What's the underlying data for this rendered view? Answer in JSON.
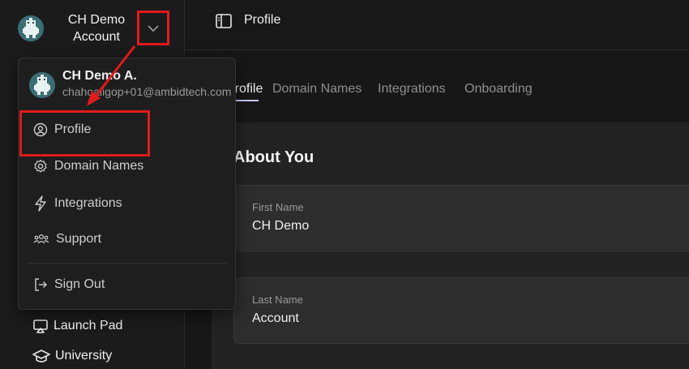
{
  "account": {
    "name_line1": "CH Demo",
    "name_line2": "Account"
  },
  "sidebar": {
    "items": [
      {
        "label": "Launch Pad",
        "icon": "airplay-icon"
      },
      {
        "label": "University",
        "icon": "graduation-cap-icon"
      }
    ]
  },
  "topbar": {
    "title": "Profile",
    "icon": "sidebar-panel-icon"
  },
  "tabs": [
    {
      "label": "Profile",
      "active": true
    },
    {
      "label": "Domain Names",
      "active": false
    },
    {
      "label": "Integrations",
      "active": false
    },
    {
      "label": "Onboarding",
      "active": false
    }
  ],
  "section": {
    "title": "About You"
  },
  "fields": [
    {
      "label": "First Name",
      "value": "CH Demo"
    },
    {
      "label": "Last Name",
      "value": "Account"
    }
  ],
  "menu": {
    "user_name": "CH Demo A.",
    "user_email": "chahoaligop+01@ambidtech.com",
    "items": [
      {
        "label": "Profile",
        "icon": "user-circle-icon"
      },
      {
        "label": "Domain Names",
        "icon": "gear-icon"
      },
      {
        "label": "Integrations",
        "icon": "lightning-icon"
      },
      {
        "label": "Support",
        "icon": "users-icon"
      },
      {
        "label": "Sign Out",
        "icon": "sign-out-icon"
      }
    ]
  },
  "colors": {
    "annotation": "#e01b1b",
    "tab_accent": "#c9c9ff",
    "avatar": "#3c6c74"
  }
}
